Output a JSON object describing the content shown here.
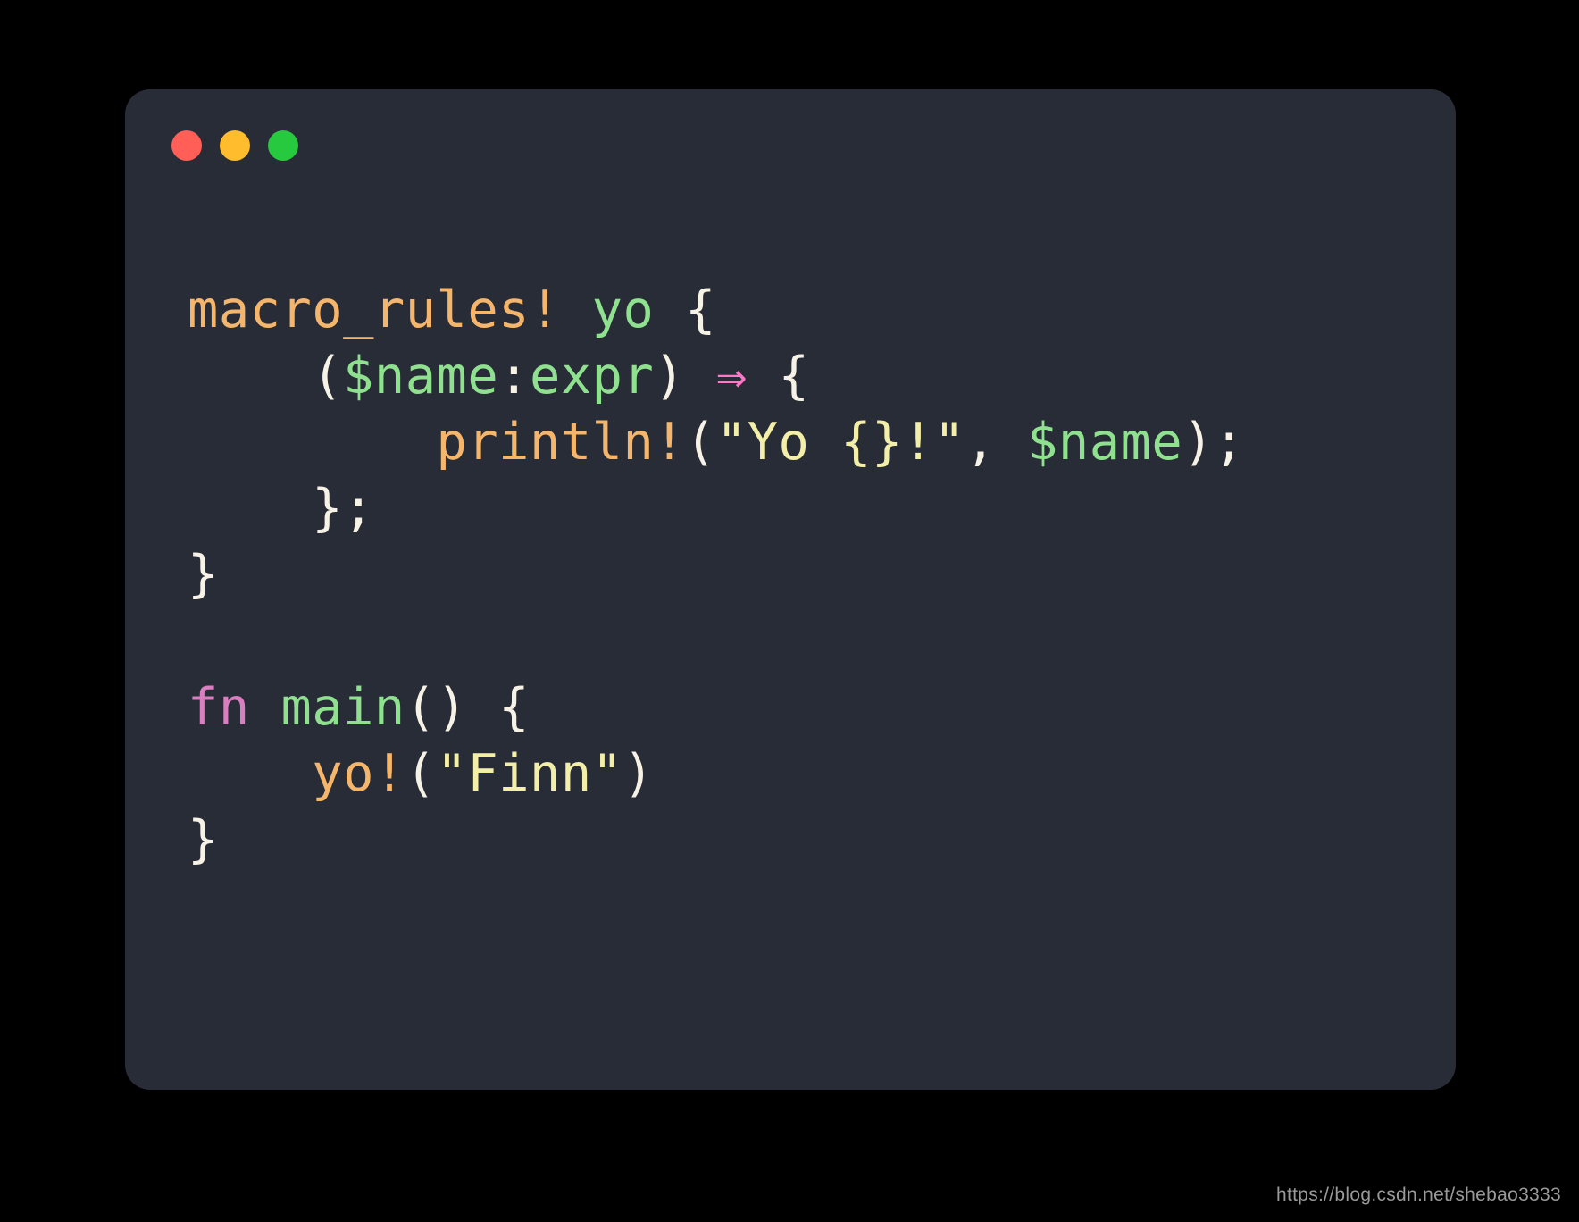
{
  "window": {
    "traffic_lights": [
      "close",
      "minimize",
      "zoom"
    ]
  },
  "code": {
    "tokens": [
      [
        {
          "t": "macro_rules!",
          "c": "c-orange"
        },
        {
          "t": " ",
          "c": "c-default"
        },
        {
          "t": "yo",
          "c": "c-green"
        },
        {
          "t": " {",
          "c": "c-default"
        }
      ],
      [
        {
          "t": "    (",
          "c": "c-default"
        },
        {
          "t": "$name",
          "c": "c-green"
        },
        {
          "t": ":",
          "c": "c-default"
        },
        {
          "t": "expr",
          "c": "c-green"
        },
        {
          "t": ") ",
          "c": "c-default"
        },
        {
          "t": "⇒",
          "c": "c-pink"
        },
        {
          "t": " {",
          "c": "c-default"
        }
      ],
      [
        {
          "t": "        ",
          "c": "c-default"
        },
        {
          "t": "println!",
          "c": "c-orange"
        },
        {
          "t": "(",
          "c": "c-default"
        },
        {
          "t": "\"Yo {}!\"",
          "c": "c-string"
        },
        {
          "t": ", ",
          "c": "c-default"
        },
        {
          "t": "$name",
          "c": "c-green"
        },
        {
          "t": ");",
          "c": "c-default"
        }
      ],
      [
        {
          "t": "    };",
          "c": "c-default"
        }
      ],
      [
        {
          "t": "}",
          "c": "c-default"
        }
      ],
      [
        {
          "t": "",
          "c": "c-default"
        }
      ],
      [
        {
          "t": "fn",
          "c": "c-magenta"
        },
        {
          "t": " ",
          "c": "c-default"
        },
        {
          "t": "main",
          "c": "c-green"
        },
        {
          "t": "() {",
          "c": "c-default"
        }
      ],
      [
        {
          "t": "    ",
          "c": "c-default"
        },
        {
          "t": "yo!",
          "c": "c-orange"
        },
        {
          "t": "(",
          "c": "c-default"
        },
        {
          "t": "\"Finn\"",
          "c": "c-string"
        },
        {
          "t": ")",
          "c": "c-default"
        }
      ],
      [
        {
          "t": "}",
          "c": "c-default"
        }
      ]
    ]
  },
  "watermark": "https://blog.csdn.net/shebao3333"
}
